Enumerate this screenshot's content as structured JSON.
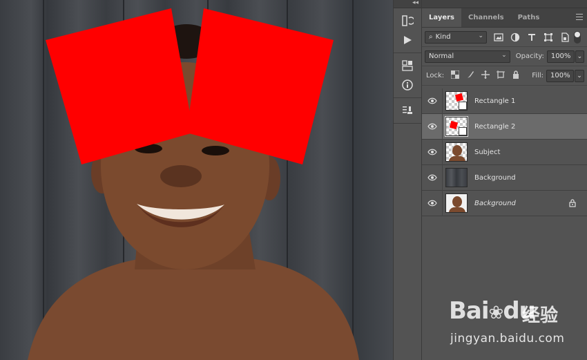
{
  "panel": {
    "tabs": [
      {
        "label": "Layers",
        "active": true
      },
      {
        "label": "Channels",
        "active": false
      },
      {
        "label": "Paths",
        "active": false
      }
    ],
    "filter_kind": "Kind",
    "blend_mode": "Normal",
    "opacity_label": "Opacity:",
    "opacity_value": "100%",
    "lock_label": "Lock:",
    "fill_label": "Fill:",
    "fill_value": "100%"
  },
  "layers": [
    {
      "name": "Rectangle 1",
      "selected": false,
      "italic": false,
      "locked": false,
      "thumb": "checker-rect"
    },
    {
      "name": "Rectangle 2",
      "selected": true,
      "italic": false,
      "locked": false,
      "thumb": "checker-rect"
    },
    {
      "name": "Subject",
      "selected": false,
      "italic": false,
      "locked": false,
      "thumb": "subject"
    },
    {
      "name": "Background",
      "selected": false,
      "italic": false,
      "locked": false,
      "thumb": "wood"
    },
    {
      "name": "Background",
      "selected": false,
      "italic": true,
      "locked": true,
      "thumb": "photo"
    }
  ],
  "watermark": {
    "logo": "Bai",
    "logo_suffix": "du",
    "chinese": "经验",
    "url": "jingyan.baidu.com"
  },
  "colors": {
    "rect_red": "#ff0000",
    "panel_bg": "#535353",
    "selected_row": "#6b6b6b"
  }
}
